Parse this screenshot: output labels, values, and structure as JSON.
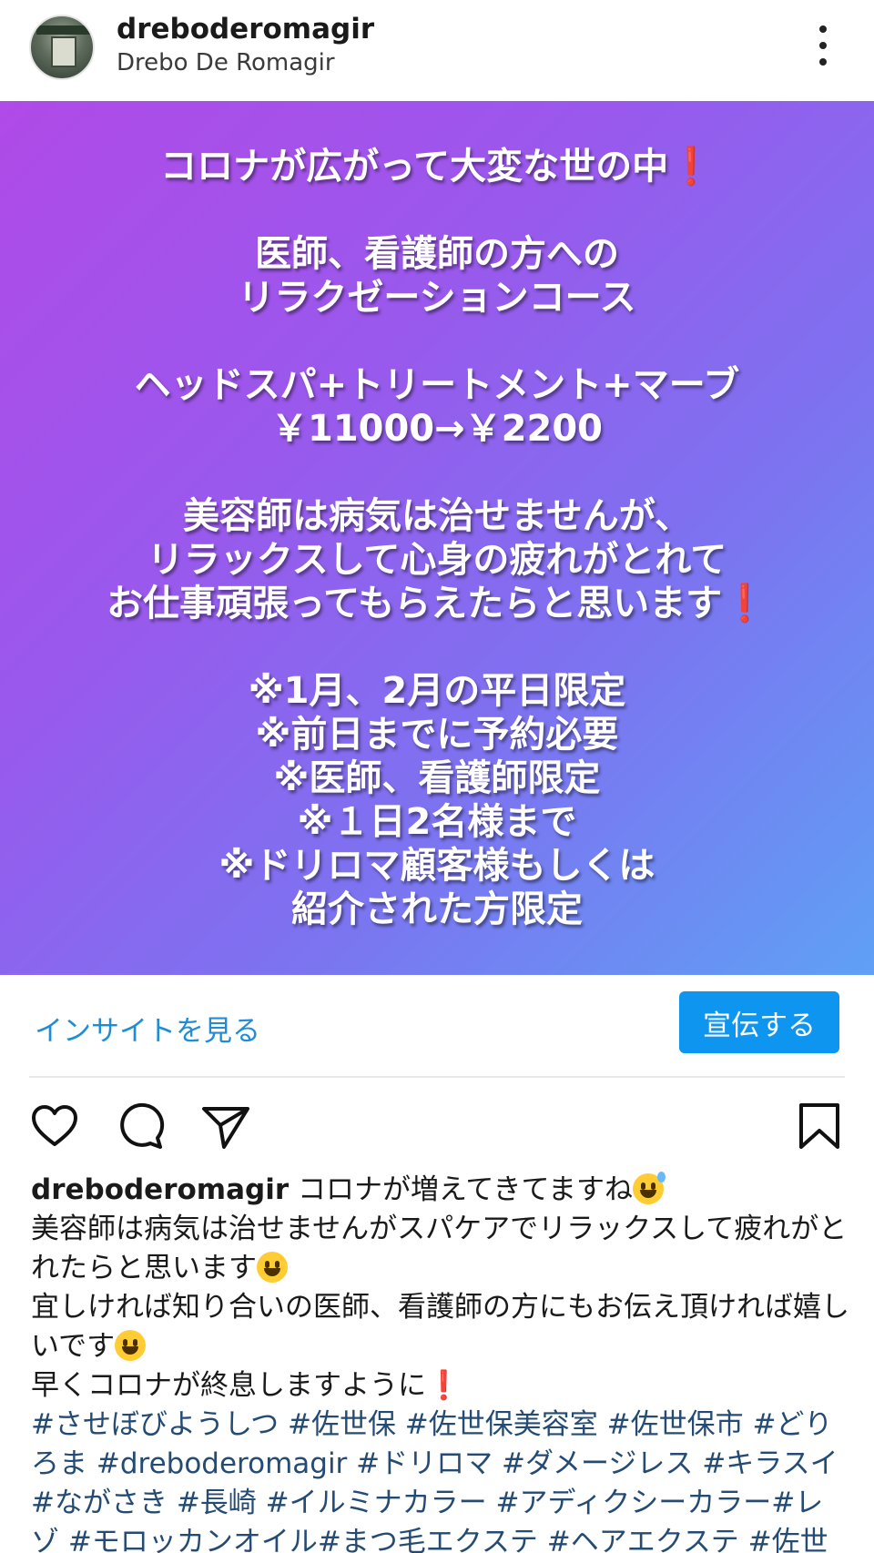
{
  "header": {
    "username": "dreboderomagir",
    "full_name": "Drebo De Romagir",
    "more_icon": "more-vertical-icon"
  },
  "post_image": {
    "background_colors": [
      "#b04ae8",
      "#5fa0f5"
    ],
    "lines": {
      "l1": "コロナが広がって大変な世の中",
      "l2": "医師、看護師の方への",
      "l3": "リラクゼーションコース",
      "l4": "ヘッドスパ+トリートメント+マーブ",
      "l5": "￥11000→￥2200",
      "l6": "美容師は病気は治せませんが、",
      "l7": "リラックスして心身の疲れがとれて",
      "l8": "お仕事頑張ってもらえたらと思います",
      "l9": "※1月、2月の平日限定",
      "l10": "※前日までに予約必要",
      "l11": "※医師、看護師限定",
      "l12": "※１日2名様まで",
      "l13": "※ドリロマ顧客様もしくは",
      "l14": "紹介された方限定"
    },
    "exclamation": "❗"
  },
  "promo": {
    "insights_label": "インサイトを見る",
    "promote_label": "宣伝する",
    "accent_color": "#0d95ef"
  },
  "actions": {
    "like_icon": "heart-icon",
    "comment_icon": "comment-icon",
    "share_icon": "send-icon",
    "save_icon": "bookmark-icon"
  },
  "caption": {
    "username": "dreboderomagir",
    "line1": " コロナが増えてきてますね",
    "line2": "美容師は病気は治せませんがスパケアでリラックスして疲れがとれたらと思います",
    "line3": "宜しければ知り合いの医師、看護師の方にもお伝え頂ければ嬉しいです",
    "line4": "早くコロナが終息しますように",
    "exclamation": "❗",
    "hashtags": "#させぼびようしつ #佐世保 #佐世保美容室 #佐世保市 #どりろま #dreboderomagir #ドリロマ #ダメージレス #キラスイ #ながさき #長崎 #イルミナカラー #アディクシーカラー#レゾ #モロッカンオイル#まつ毛エクステ #ヘアエクステ #佐世保求人"
  }
}
